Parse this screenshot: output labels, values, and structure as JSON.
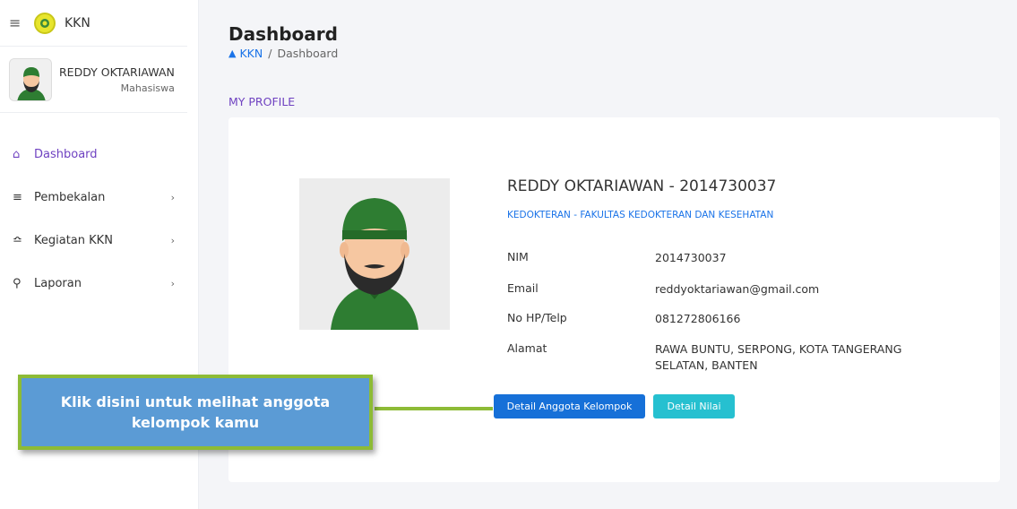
{
  "brand": {
    "name": "KKN",
    "icon": "menu-icon"
  },
  "user": {
    "name": "REDDY OKTARIAWAN",
    "role": "Mahasiswa"
  },
  "menu": [
    {
      "label": "Dashboard",
      "icon": "home-icon",
      "active": true,
      "has_children": false
    },
    {
      "label": "Pembekalan",
      "icon": "layers-icon",
      "active": false,
      "has_children": true
    },
    {
      "label": "Kegiatan KKN",
      "icon": "activity-icon",
      "active": false,
      "has_children": true
    },
    {
      "label": "Laporan",
      "icon": "search-icon",
      "active": false,
      "has_children": true
    }
  ],
  "chevron": "›",
  "page": {
    "title": "Dashboard"
  },
  "breadcrumb": {
    "home_label": "KKN",
    "separator": "/",
    "current": "Dashboard"
  },
  "section": {
    "label": "MY PROFILE"
  },
  "profile": {
    "header": "REDDY OKTARIAWAN - 2014730037",
    "faculty": "KEDOKTERAN - FAKULTAS KEDOKTERAN DAN KESEHATAN",
    "fields": [
      {
        "key": "NIM",
        "value": "2014730037"
      },
      {
        "key": "Email",
        "value": "reddyoktariawan@gmail.com"
      },
      {
        "key": "No HP/Telp",
        "value": "081272806166"
      },
      {
        "key": "Alamat",
        "value": "RAWA BUNTU, SERPONG, KOTA TANGERANG SELATAN, BANTEN"
      }
    ]
  },
  "buttons": {
    "detail_group": "Detail Anggota Kelompok",
    "detail_score": "Detail Nilai"
  },
  "callout": {
    "text": "Klik disini untuk melihat anggota kelompok kamu"
  },
  "colors": {
    "accent": "#6f42c1",
    "primary": "#1670d8",
    "info": "#26c0d0",
    "callout_bg": "#5b9bd5",
    "callout_border": "#8dbb36"
  }
}
